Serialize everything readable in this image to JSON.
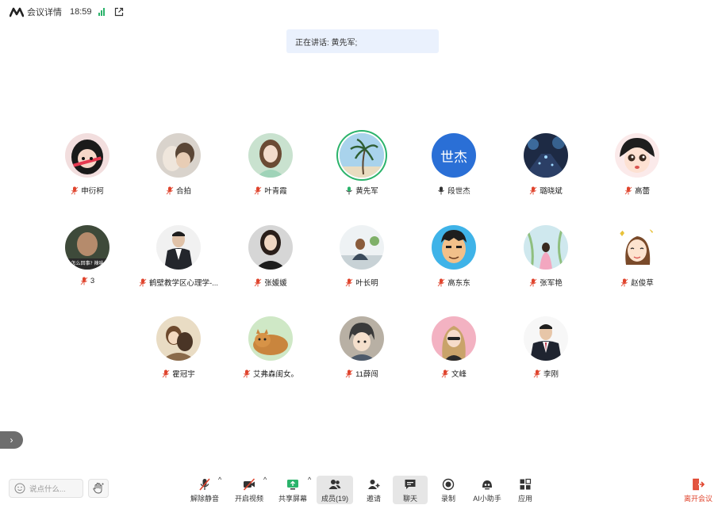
{
  "topbar": {
    "title": "会议详情",
    "time": "18:59"
  },
  "speaking": "正在讲话: 黄先军;",
  "participants": [
    {
      "name": "申衍柯",
      "mic": "muted"
    },
    {
      "name": "合拍",
      "mic": "muted"
    },
    {
      "name": "叶青霞",
      "mic": "muted"
    },
    {
      "name": "黄先军",
      "mic": "speaking"
    },
    {
      "name": "段世杰",
      "mic": "on",
      "avatar_text": "世杰"
    },
    {
      "name": "璐晓斌",
      "mic": "muted"
    },
    {
      "name": "高蕾",
      "mic": "muted"
    },
    {
      "name": "3",
      "mic": "muted",
      "avatar_text": "怎么回事? 辣味"
    },
    {
      "name": "鹤壁教学区心理学-...",
      "mic": "muted"
    },
    {
      "name": "张媛媛",
      "mic": "muted"
    },
    {
      "name": "叶长明",
      "mic": "muted"
    },
    {
      "name": "高东东",
      "mic": "muted"
    },
    {
      "name": "张军艳",
      "mic": "muted"
    },
    {
      "name": "赵俊草",
      "mic": "muted"
    },
    {
      "name": "霍冠宇",
      "mic": "muted"
    },
    {
      "name": "艾弗森闺女。",
      "mic": "muted"
    },
    {
      "name": "11薛闯",
      "mic": "muted"
    },
    {
      "name": "文峰",
      "mic": "muted"
    },
    {
      "name": "李刚",
      "mic": "muted"
    }
  ],
  "toolbar": {
    "chat_placeholder": "说点什么...",
    "buttons": [
      {
        "label": "解除静音",
        "icon": "mic-muted-icon"
      },
      {
        "label": "开启视频",
        "icon": "camera-off-icon"
      },
      {
        "label": "共享屏幕",
        "icon": "share-screen-icon"
      },
      {
        "label": "成员(19)",
        "icon": "members-icon"
      },
      {
        "label": "邀请",
        "icon": "invite-icon"
      },
      {
        "label": "聊天",
        "icon": "chat-icon"
      },
      {
        "label": "录制",
        "icon": "record-icon"
      },
      {
        "label": "AI小助手",
        "icon": "ai-assistant-icon"
      },
      {
        "label": "应用",
        "icon": "apps-icon"
      }
    ],
    "leave_label": "离开会议"
  },
  "colors": {
    "speaking_ring": "#2bb36b",
    "leave": "#e0452e",
    "speaking_bg": "#eaf1fd"
  }
}
